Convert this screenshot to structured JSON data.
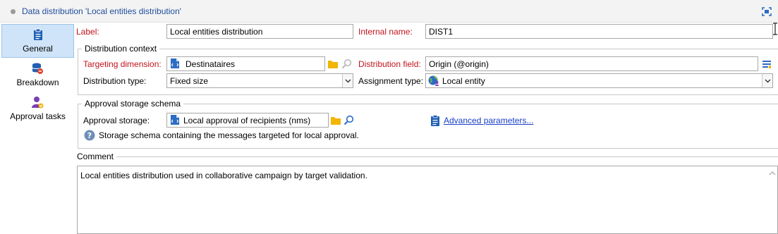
{
  "window": {
    "title": "Data distribution 'Local entities distribution'"
  },
  "sidebar": {
    "items": [
      {
        "label": "General",
        "icon": "clipboard-icon",
        "active": true
      },
      {
        "label": "Breakdown",
        "icon": "database-icon",
        "active": false
      },
      {
        "label": "Approval tasks",
        "icon": "user-check-icon",
        "active": false
      }
    ]
  },
  "form": {
    "label_caption": "Label:",
    "label_value": "Local entities distribution",
    "internal_name_caption": "Internal name:",
    "internal_name_value": "DIST1"
  },
  "distribution_context": {
    "title": "Distribution context",
    "targeting_dimension_caption": "Targeting dimension:",
    "targeting_dimension_value": "Destinataires",
    "distribution_field_caption": "Distribution field:",
    "distribution_field_value": "Origin (@origin)",
    "distribution_type_caption": "Distribution type:",
    "distribution_type_value": "Fixed size",
    "assignment_type_caption": "Assignment type:",
    "assignment_type_value": "Local entity"
  },
  "approval_storage": {
    "title": "Approval storage schema",
    "storage_caption": "Approval storage:",
    "storage_value": "Local approval of recipients (nms)",
    "advanced_link": "Advanced parameters...",
    "help_text": "Storage schema containing the messages targeted for local approval."
  },
  "comment": {
    "title": "Comment",
    "value": "Local entities distribution used in collaborative campaign by target validation."
  },
  "colors": {
    "title_blue": "#1f4e9c",
    "required_red": "#c0141c",
    "active_bg": "#cfe4f8",
    "link_blue": "#1a3ec7",
    "folder_yellow": "#f2b500"
  }
}
